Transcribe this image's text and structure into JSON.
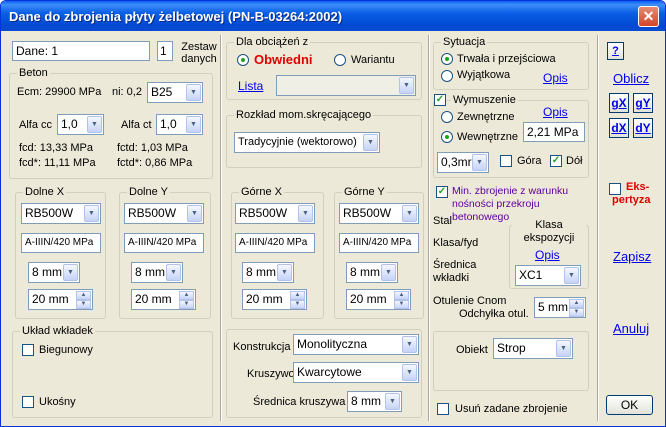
{
  "window": {
    "title": "Dane do zbrojenia płyty żelbetowej (PN-B-03264:2002)",
    "close": "✕"
  },
  "dane": {
    "name_value": "Dane: 1",
    "count_value": "1",
    "zestaw_label": "Zestaw danych"
  },
  "beton": {
    "group": "Beton",
    "ecm": "Ecm: 29900 MPa",
    "ni": "ni: 0,2",
    "klasa": "B25",
    "alfa_cc_label": "Alfa cc",
    "alfa_cc": "1,0",
    "alfa_ct_label": "Alfa ct",
    "alfa_ct": "1,0",
    "fcd": "fcd: 13,33 MPa",
    "fcdstar": "fcd*: 11,11 MPa",
    "fctd": "fctd: 1,03 MPa",
    "fctdstar": "fctd*: 0,86 MPa"
  },
  "dolne_x": {
    "group": "Dolne X",
    "stal": "RB500W",
    "klasa": "A-IIIN/420 MPa",
    "srednica": "8 mm",
    "otulenie": "20 mm"
  },
  "dolne_y": {
    "group": "Dolne Y",
    "stal": "RB500W",
    "klasa": "A-IIIN/420 MPa",
    "srednica": "8 mm",
    "otulenie": "20 mm"
  },
  "gorne_x": {
    "group": "Górne X",
    "stal": "RB500W",
    "klasa": "A-IIIN/420 MPa",
    "srednica": "8 mm",
    "otulenie": "20 mm"
  },
  "gorne_y": {
    "group": "Górne Y",
    "stal": "RB500W",
    "klasa": "A-IIIN/420 MPa",
    "srednica": "8 mm",
    "otulenie": "20 mm"
  },
  "obciazenia": {
    "group": "Dla obciążeń z",
    "obwiedni": "Obwiedni",
    "wariantu": "Wariantu",
    "lista": "Lista",
    "lista_value": ""
  },
  "rozklad": {
    "group": "Rozkład mom.skręcającego",
    "value": "Tradycyjnie (wektorowo)"
  },
  "sytuacja": {
    "group": "Sytuacja",
    "trwala": "Trwała i przejściowa",
    "wyjatkowa": "Wyjątkowa",
    "opis": "Opis"
  },
  "wymuszenie": {
    "label": "Wymuszenie",
    "opis": "Opis",
    "zewnetrzne": "Zewnętrzne",
    "wewnetrzne": "Wewnętrzne",
    "value": "2,21 MPa",
    "grubosc": "0,3mr",
    "gora": "Góra",
    "dol": "Dół"
  },
  "min_zbrojenie": "Min. zbrojenie z warunku nośności przekroju betonowego",
  "labels": {
    "stal": "Stal",
    "klasa_fyd": "Klasa/fyd",
    "srednica_wkladki": "Średnica wkładki"
  },
  "ekspozycja": {
    "group": "Klasa ekspozycji",
    "opis": "Opis",
    "value": "XC1"
  },
  "otulenie": {
    "label": "Otulenie Cnom",
    "odchylka_label": "Odchyłka otul.",
    "odchylka": "5 mm"
  },
  "uklad": {
    "group": "Układ wkładek",
    "biegunowy": "Biegunowy",
    "ukosny": "Ukośny"
  },
  "konstrukcja": {
    "label": "Konstrukcja",
    "value": "Monolityczna",
    "kruszywo_label": "Kruszywo",
    "kruszywo": "Kwarcytowe",
    "srednica_label": "Średnica kruszywa",
    "srednica": "8 mm"
  },
  "obiekt": {
    "label": "Obiekt",
    "value": "Strop"
  },
  "usun": "Usuń zadane zbrojenie",
  "side": {
    "help": "?",
    "oblicz": "Oblicz",
    "gx": "gX",
    "gy": "gY",
    "dx": "dX",
    "dy": "dY",
    "ekspertyza_1": "Eks-",
    "ekspertyza_2": "pertyza",
    "zapisz": "Zapisz",
    "anuluj": "Anuluj",
    "ok": "OK"
  },
  "colors": {
    "accent_red": "#e00000",
    "purple": "#6000a0",
    "title_blue": "#0a5fe6"
  }
}
